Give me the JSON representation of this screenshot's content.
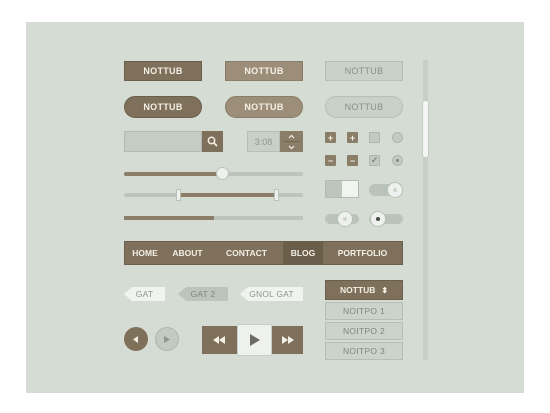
{
  "colors": {
    "background": "#d5dcd4",
    "brand_dark": "#7e705a",
    "brand_mid": "#9c8e78",
    "light": "#eef1ed"
  },
  "buttons": {
    "row1": [
      "NOTTUB",
      "NOTTUB",
      "NOTTUB"
    ],
    "row2": [
      "NOTTUB",
      "NOTTUB",
      "NOTTUB"
    ]
  },
  "search": {
    "value": "",
    "icon": "search-icon"
  },
  "time": {
    "value": "3:08",
    "icons": [
      "chevron-up-icon",
      "chevron-down-icon"
    ]
  },
  "checkboxes": {
    "row1": [
      "+",
      "+"
    ],
    "row2": [
      "−",
      "−"
    ],
    "checked_glyph": "✓"
  },
  "sliders": {
    "single_value": 0.55,
    "range": [
      0.3,
      0.85
    ],
    "progress": 0.5
  },
  "toggles": {
    "switch_a_on": false,
    "switch_b_on": true
  },
  "nav": {
    "items": [
      "HOME",
      "ABOUT",
      "CONTACT",
      "BLOG",
      "PORTFOLIO"
    ],
    "active": "BLOG"
  },
  "tags": [
    "GAT",
    "GAT 2",
    "GNOL GAT"
  ],
  "media": {
    "icons": [
      "rewind-icon",
      "play-icon",
      "fast-forward-icon"
    ]
  },
  "dropdown": {
    "label": "NOTTUB",
    "glyph": "⬍",
    "options": [
      "NOITPO 1",
      "NOITPO 2",
      "NOITPO 3"
    ]
  }
}
